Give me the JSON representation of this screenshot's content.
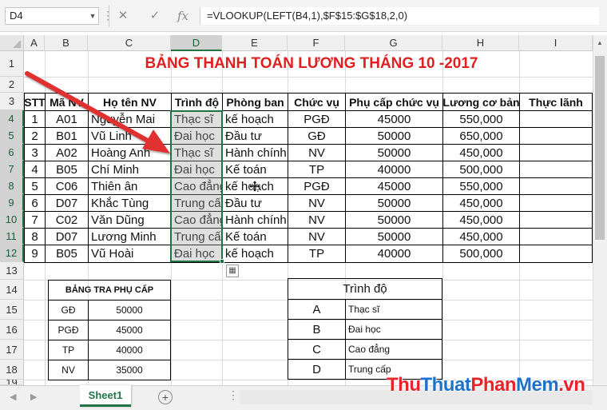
{
  "formula_bar": {
    "name_box": "D4",
    "cancel_icon": "✕",
    "enter_icon": "✓",
    "fx_label": "fx",
    "formula": "=VLOOKUP(LEFT(B4,1),$F$15:$G$18,2,0)"
  },
  "columns": [
    "A",
    "B",
    "C",
    "D",
    "E",
    "F",
    "G",
    "H",
    "I"
  ],
  "rows": [
    "1",
    "2",
    "3",
    "4",
    "5",
    "6",
    "7",
    "8",
    "9",
    "10",
    "11",
    "12",
    "13",
    "14",
    "15",
    "16",
    "17",
    "18",
    "19"
  ],
  "title": "BẢNG THANH TOÁN LƯƠNG THÁNG 10 -2017",
  "main_table": {
    "headers": [
      "STT",
      "Mã NV",
      "Họ tên NV",
      "Trình độ",
      "Phòng ban",
      "Chức vụ",
      "Phụ cấp chức vụ",
      "Lương cơ bản",
      "Thực lãnh"
    ],
    "rows": [
      [
        "1",
        "A01",
        "Nguyễn Mai",
        "Thạc sĩ",
        "kế hoạch",
        "PGĐ",
        "45000",
        "550,000",
        ""
      ],
      [
        "2",
        "B01",
        "Vũ Linh",
        "Đai học",
        "Đầu tư",
        "GĐ",
        "50000",
        "650,000",
        ""
      ],
      [
        "3",
        "A02",
        "Hoàng Anh",
        "Thạc sĩ",
        "Hành chính",
        "NV",
        "50000",
        "450,000",
        ""
      ],
      [
        "4",
        "B05",
        "Chí Minh",
        "Đai học",
        "Kế toán",
        "TP",
        "40000",
        "500,000",
        ""
      ],
      [
        "5",
        "C06",
        "Thiên ân",
        "Cao đẳng",
        "kế hoạch",
        "PGĐ",
        "45000",
        "550,000",
        ""
      ],
      [
        "6",
        "D07",
        "Khắc Tùng",
        "Trung cấp",
        "Đầu tư",
        "NV",
        "50000",
        "450,000",
        ""
      ],
      [
        "7",
        "C02",
        "Văn Dũng",
        "Cao đẳng",
        "Hành chính",
        "NV",
        "50000",
        "450,000",
        ""
      ],
      [
        "8",
        "D07",
        "Lương Minh",
        "Trung cấp",
        "Kế toán",
        "NV",
        "50000",
        "450,000",
        ""
      ],
      [
        "9",
        "B05",
        "Vũ Hoài",
        "Đai học",
        "kế hoạch",
        "TP",
        "40000",
        "500,000",
        ""
      ]
    ]
  },
  "allowance_table": {
    "title": "BẢNG TRA PHỤ CẤP",
    "rows": [
      [
        "GĐ",
        "50000"
      ],
      [
        "PGĐ",
        "45000"
      ],
      [
        "TP",
        "40000"
      ],
      [
        "NV",
        "35000"
      ]
    ]
  },
  "level_table": {
    "title": "Trình độ",
    "rows": [
      [
        "A",
        "Thạc sĩ"
      ],
      [
        "B",
        "Đai học"
      ],
      [
        "C",
        "Cao đẳng"
      ],
      [
        "D",
        "Trung cấp"
      ]
    ]
  },
  "sheet_tab": "Sheet1",
  "add_sheet": "+",
  "watermark": {
    "part1": "Thu",
    "part2": "Thuat",
    "part3": "Phan",
    "part4": "Mem",
    "part5": ".vn"
  },
  "colors": {
    "accent": "#217346",
    "title_red": "#e02020",
    "arrow_red": "#e03030"
  }
}
